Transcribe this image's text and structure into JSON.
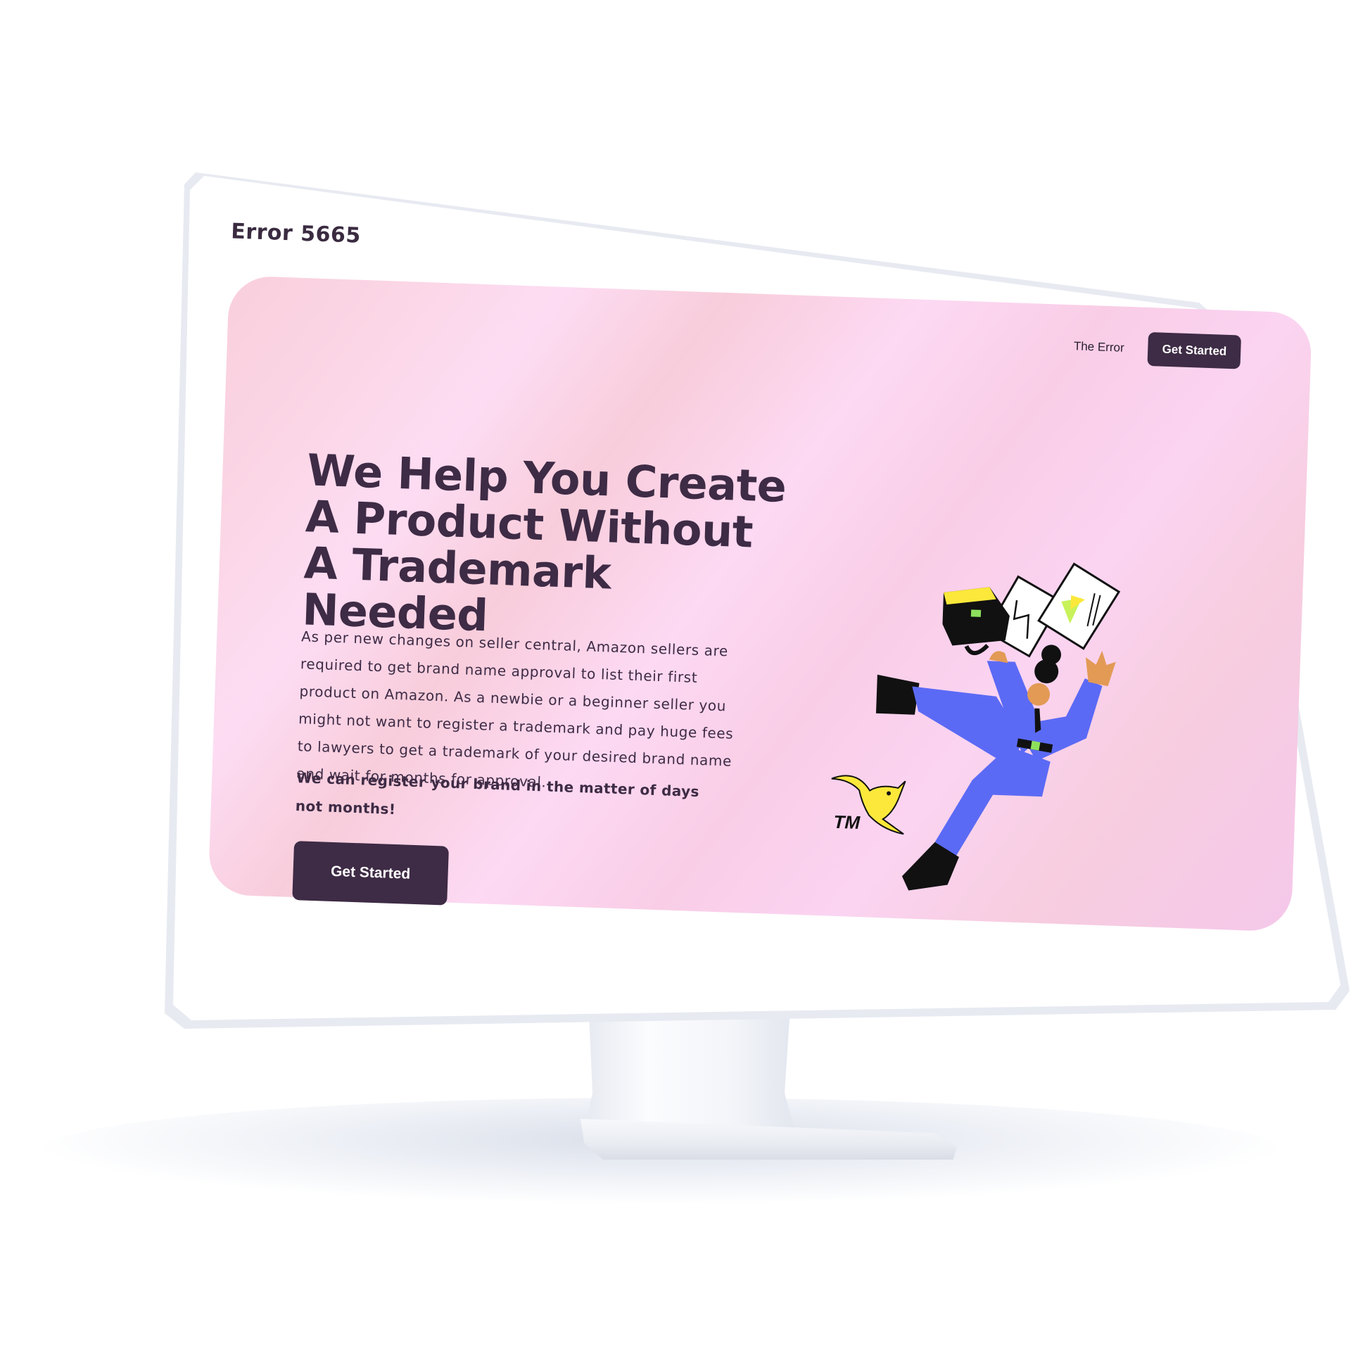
{
  "header": {
    "brand": "Error 5665"
  },
  "nav": {
    "link": "The Error",
    "cta": "Get Started"
  },
  "hero": {
    "title": "We Help You Create A Product Without A Trademark Needed",
    "description": "As per new changes on seller central, Amazon sellers are required to get brand name approval to list their first product on Amazon. As a newbie or a beginner seller you might not want to register a trademark and pay huge fees to lawyers to get a trademark of your desired brand name and wait for months for approval.",
    "emphasis": "We can register your brand in the matter of days not months!",
    "cta": "Get Started",
    "illustration_label": "TM"
  },
  "colors": {
    "primary": "#3e2b45",
    "hero_gradient": [
      "#f9cfdc",
      "#fddcf3",
      "#f5c8ea"
    ],
    "suit": "#5b6af5",
    "accent_yellow": "#fbe83a",
    "skin": "#e29a55"
  },
  "icons": [
    "briefcase-icon",
    "document-icon",
    "bird-icon"
  ]
}
